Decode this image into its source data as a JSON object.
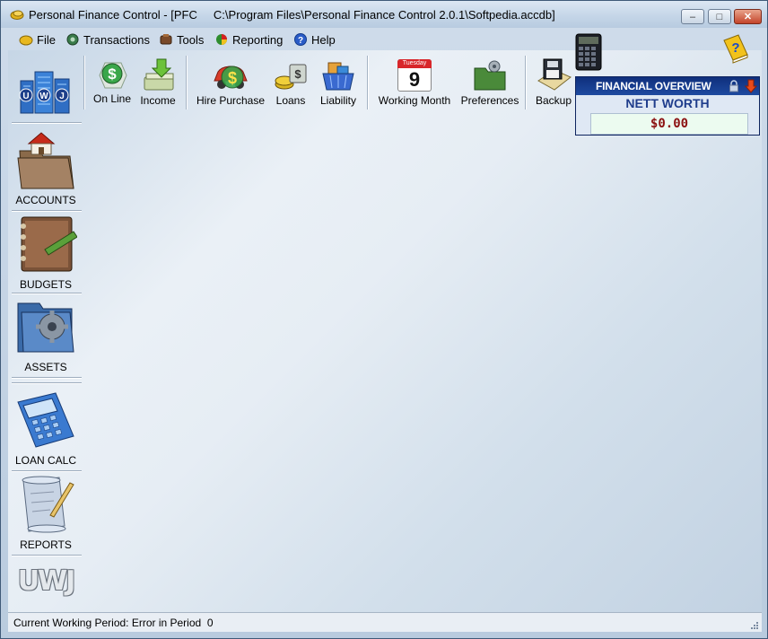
{
  "window": {
    "title": "Personal Finance Control - [PFC     C:\\Program Files\\Personal Finance Control 2.0.1\\Softpedia.accdb]",
    "minimize_label": "–",
    "maximize_label": "□",
    "close_label": "✕"
  },
  "menu": {
    "items": [
      {
        "label": "File",
        "icon": "folder-icon"
      },
      {
        "label": "Transactions",
        "icon": "transactions-icon"
      },
      {
        "label": "Tools",
        "icon": "tools-icon"
      },
      {
        "label": "Reporting",
        "icon": "pie-chart-icon"
      },
      {
        "label": "Help",
        "icon": "help-icon"
      }
    ]
  },
  "toolbar": {
    "buttons": [
      {
        "label": "On Line",
        "icon": "online-dollar-icon"
      },
      {
        "label": "Income",
        "icon": "income-money-icon"
      },
      {
        "label": "Hire Purchase",
        "icon": "car-dollar-icon"
      },
      {
        "label": "Loans",
        "icon": "coins-icon"
      },
      {
        "label": "Liability",
        "icon": "shopping-basket-icon"
      },
      {
        "label": "Working Month",
        "icon": "calendar-icon",
        "calendar_weekday": "Tuesday",
        "calendar_day": "9"
      },
      {
        "label": "Preferences",
        "icon": "preferences-folder-icon"
      },
      {
        "label": "Backup",
        "icon": "floppy-disk-icon"
      }
    ]
  },
  "logo": {
    "letters": [
      "U",
      "W",
      "J"
    ]
  },
  "sidebar": {
    "buttons": [
      {
        "label": "ACCOUNTS",
        "icon": "house-folder-icon"
      },
      {
        "label": "BUDGETS",
        "icon": "budget-book-icon"
      },
      {
        "label": "ASSETS",
        "icon": "assets-gear-icon"
      },
      {
        "label": "LOAN CALC",
        "icon": "calculator-icon"
      },
      {
        "label": "REPORTS",
        "icon": "scroll-quill-icon"
      }
    ],
    "footer_logo": "UWJ"
  },
  "financial_overview": {
    "title": "FINANCIAL OVERVIEW",
    "nett_worth_label": "NETT WORTH",
    "nett_worth_value": "$0.00"
  },
  "status": {
    "text": "Current Working Period: Error in Period  0"
  },
  "colors": {
    "panel_blue": "#1f3d8c",
    "value_red": "#8b1010",
    "value_bg": "#ecfbf0"
  }
}
